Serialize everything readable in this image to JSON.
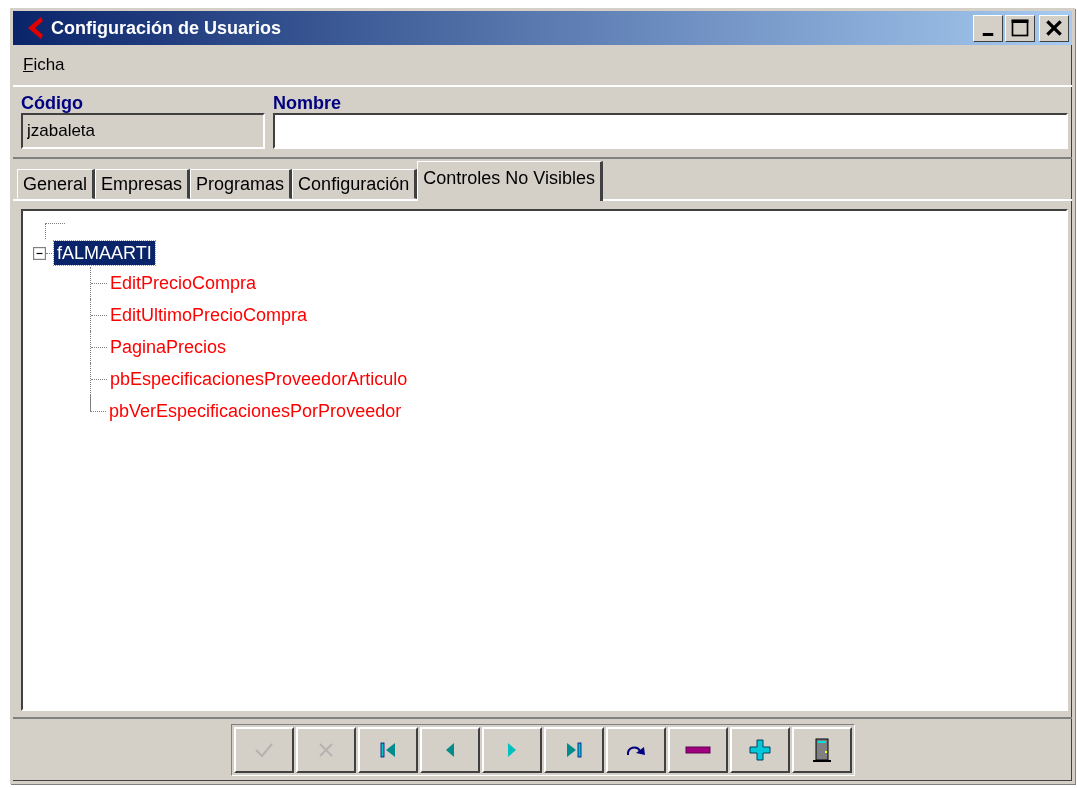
{
  "window": {
    "title": "Configuración de Usuarios"
  },
  "menu": [
    {
      "label": "Ficha"
    }
  ],
  "fields": [
    {
      "label": "Código",
      "value": "jzabaleta",
      "disabled": true
    },
    {
      "label": "Nombre",
      "disabled": false
    }
  ],
  "tabs": [
    {
      "label": "General",
      "selected": false
    },
    {
      "label": "Empresas",
      "selected": false
    },
    {
      "label": "Programas",
      "selected": false
    },
    {
      "label": "Configuración",
      "selected": false
    },
    {
      "label": "Controles No Visibles",
      "selected": true
    }
  ],
  "tree": [
    {
      "label": "fALMAARTI",
      "selected": true,
      "expanded": true,
      "children": [
        {
          "label": "EditPrecioCompra",
          "selected": false
        },
        {
          "label": "EditUltimoPrecioCompra",
          "selected": false
        },
        {
          "label": "PaginaPrecios",
          "selected": false
        },
        {
          "label": "pbEspecificacionesProveedorArticulo",
          "selected": false
        },
        {
          "label": "pbVerEspecificacionesPorProveedor",
          "selected": false
        }
      ]
    }
  ],
  "toolbar": [
    {
      "kind": "confirm",
      "disabled": true
    },
    {
      "kind": "cancel",
      "disabled": true
    },
    {
      "kind": "first",
      "disabled": false
    },
    {
      "kind": "prev",
      "disabled": false
    },
    {
      "kind": "next",
      "disabled": false
    },
    {
      "kind": "last",
      "disabled": false
    },
    {
      "kind": "refresh",
      "disabled": false
    },
    {
      "kind": "delete",
      "disabled": false
    },
    {
      "kind": "add",
      "disabled": false
    },
    {
      "kind": "exit",
      "disabled": false
    }
  ]
}
